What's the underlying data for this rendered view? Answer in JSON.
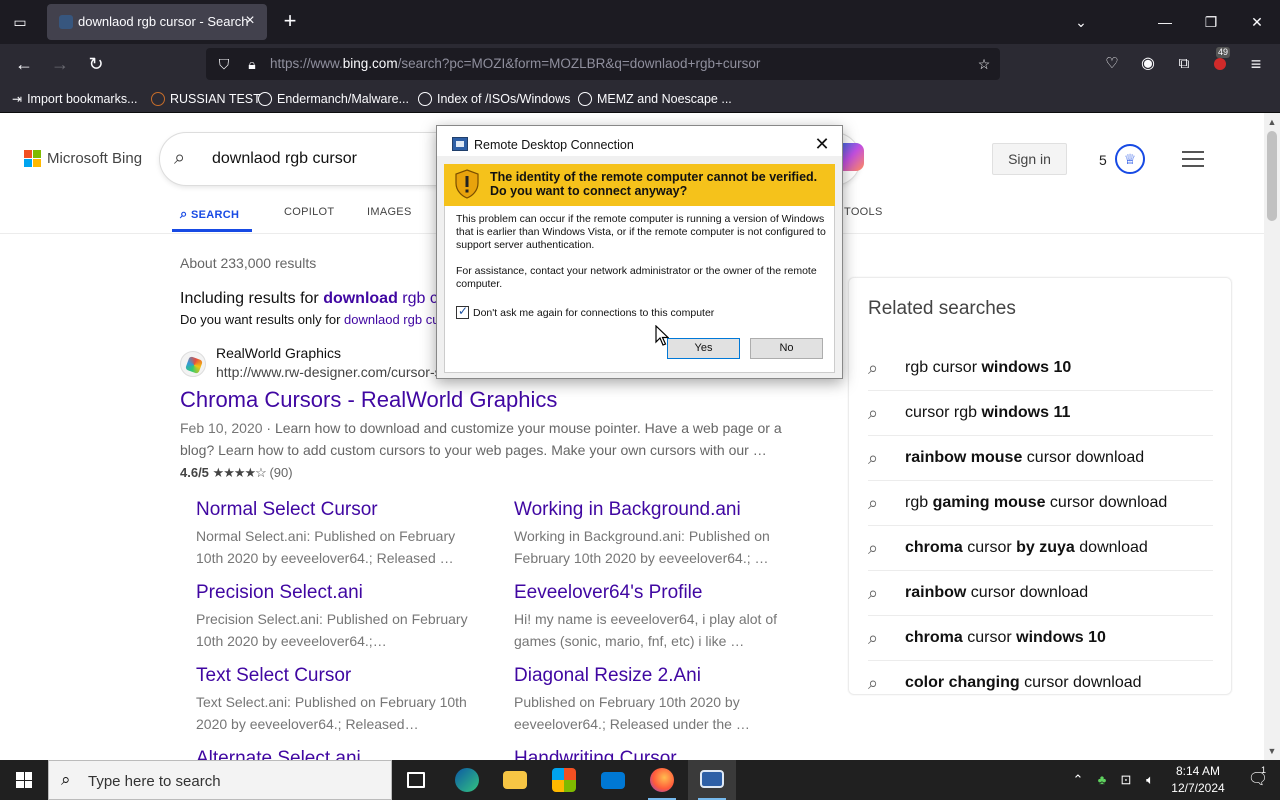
{
  "browser": {
    "tab_title": "downlaod rgb cursor - Search",
    "url_prefix": "https://www.",
    "url_host": "bing.com",
    "url_rest": "/search?pc=MOZI&form=MOZLBR&q=downlaod+rgb+cursor",
    "extension_badge": "49",
    "bookmarks": [
      "Import bookmarks...",
      "RUSSIAN TEST",
      "Endermanch/Malware...",
      "Index of /ISOs/Windows",
      "MEMZ and Noescape ..."
    ]
  },
  "bing": {
    "logo_text": "Microsoft Bing",
    "query": "downlaod rgb cursor",
    "sign_in": "Sign in",
    "rewards_count": "5",
    "scopes": [
      "SEARCH",
      "COPILOT",
      "IMAGES",
      "TOOLS"
    ],
    "result_count": "About 233,000 results",
    "including_prefix": "Including results for ",
    "including_bold": "download",
    "including_rest": " rgb c",
    "didyou_prefix": "Do you want results only for ",
    "didyou_link": "downlaod rgb cu",
    "result": {
      "site_name": "RealWorld Graphics",
      "site_url": "http://www.rw-designer.com/cursor-s",
      "title": "Chroma Cursors - RealWorld Graphics",
      "date": "Feb 10, 2020",
      "snippet": " · Learn how to download and customize your mouse pointer. Have a web page or a blog? Learn how to add custom cursors to your web pages. Make your own cursors with our …",
      "rating": "4.6/5",
      "stars": "★★★★☆",
      "rating_count": "(90)"
    },
    "deep_links": [
      {
        "title": "Normal Select Cursor",
        "snippet": "Normal Select.ani: Published on February 10th 2020 by eeveelover64.; Released …"
      },
      {
        "title": "Working in Background.ani",
        "snippet": "Working in Background.ani: Published on February 10th 2020 by eeveelover64.; …"
      },
      {
        "title": "Precision Select.ani",
        "snippet": "Precision Select.ani: Published on February 10th 2020 by eeveelover64.;…"
      },
      {
        "title": "Eeveelover64's Profile",
        "snippet": "Hi! my name is eeveelover64, i play alot of games (sonic, mario, fnf, etc) i like …"
      },
      {
        "title": "Text Select Cursor",
        "snippet": "Text Select.ani: Published on February 10th 2020 by eeveelover64.; Released…"
      },
      {
        "title": "Diagonal Resize 2.Ani",
        "snippet": "Published on February 10th 2020 by eeveelover64.; Released under the …"
      },
      {
        "title": "Alternate Select.ani",
        "snippet": ""
      },
      {
        "title": "Handwriting Cursor",
        "snippet": ""
      }
    ],
    "related_title": "Related searches",
    "related": [
      [
        {
          "t": "rgb cursor ",
          "b": false
        },
        {
          "t": "windows 10",
          "b": true
        }
      ],
      [
        {
          "t": "cursor rgb ",
          "b": false
        },
        {
          "t": "windows 11",
          "b": true
        }
      ],
      [
        {
          "t": "rainbow mouse",
          "b": true
        },
        {
          "t": " cursor download",
          "b": false
        }
      ],
      [
        {
          "t": "rgb ",
          "b": false
        },
        {
          "t": "gaming mouse",
          "b": true
        },
        {
          "t": " cursor download",
          "b": false
        }
      ],
      [
        {
          "t": "chroma",
          "b": true
        },
        {
          "t": " cursor ",
          "b": false
        },
        {
          "t": "by zuya",
          "b": true
        },
        {
          "t": " download",
          "b": false
        }
      ],
      [
        {
          "t": "rainbow",
          "b": true
        },
        {
          "t": " cursor download",
          "b": false
        }
      ],
      [
        {
          "t": "chroma",
          "b": true
        },
        {
          "t": " cursor ",
          "b": false
        },
        {
          "t": "windows 10",
          "b": true
        }
      ],
      [
        {
          "t": "color changing",
          "b": true
        },
        {
          "t": " cursor download",
          "b": false
        }
      ]
    ]
  },
  "dialog": {
    "title": "Remote Desktop Connection",
    "warning": "The identity of the remote computer cannot be verified. Do you want to connect anyway?",
    "para1": "This problem can occur if the remote computer is running a version of Windows that is earlier than Windows Vista, or if the remote computer is not configured to support server authentication.",
    "para2": "For assistance, contact your network administrator or the owner of the remote computer.",
    "checkbox_label": "Don't ask me again for connections to this computer",
    "checkbox_checked": true,
    "yes": "Yes",
    "no": "No"
  },
  "taskbar": {
    "search_placeholder": "Type here to search",
    "time": "8:14 AM",
    "date": "12/7/2024",
    "notification_count": "1"
  },
  "colors": {
    "link_purple": "#4007a2",
    "bing_blue": "#174ae4",
    "warn_yellow": "#f5c21b",
    "ms_red": "#f25022",
    "ms_green": "#7fba00",
    "ms_blue": "#00a4ef",
    "ms_yellow": "#ffb900"
  }
}
